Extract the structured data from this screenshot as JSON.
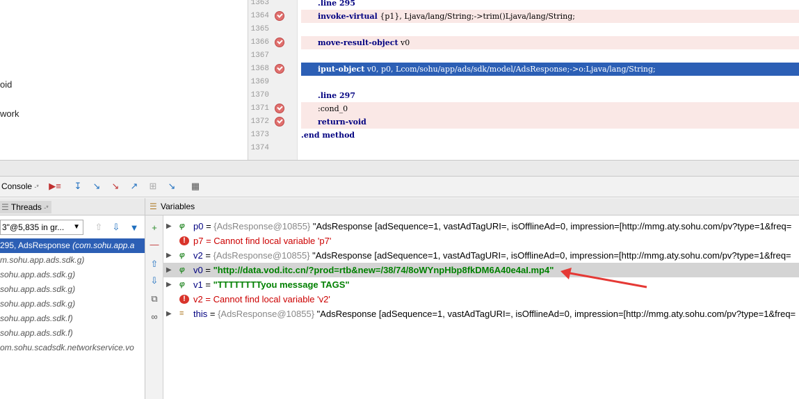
{
  "project": {
    "items": [
      "oid",
      "work"
    ]
  },
  "editor": {
    "lines": [
      {
        "num": "1363",
        "code": ".line 295",
        "bp": false,
        "indent": 1
      },
      {
        "num": "1364",
        "code": "invoke-virtual {p1}, Ljava/lang/String;->trim()Ljava/lang/String;",
        "bp": true,
        "indent": 1,
        "kw": "invoke-virtual"
      },
      {
        "num": "1365",
        "code": "",
        "bp": false,
        "indent": 1
      },
      {
        "num": "1366",
        "code": "move-result-object v0",
        "bp": true,
        "indent": 1,
        "kw": "move-result-object"
      },
      {
        "num": "1367",
        "code": "",
        "bp": false,
        "indent": 1
      },
      {
        "num": "1368",
        "code": "iput-object v0, p0, Lcom/sohu/app/ads/sdk/model/AdsResponse;->o:Ljava/lang/String;",
        "bp": true,
        "indent": 1,
        "kw": "iput-object",
        "selected": true
      },
      {
        "num": "1369",
        "code": "",
        "bp": false,
        "indent": 1
      },
      {
        "num": "1370",
        "code": ".line 297",
        "bp": false,
        "indent": 1
      },
      {
        "num": "1371",
        "code": ":cond_0",
        "bp": true,
        "indent": 1
      },
      {
        "num": "1372",
        "code": "return-void",
        "bp": true,
        "indent": 1,
        "kw": "return-void"
      },
      {
        "num": "1373",
        "code": ".end method",
        "bp": false,
        "indent": 0
      },
      {
        "num": "1374",
        "code": "",
        "bp": false,
        "indent": 0
      }
    ]
  },
  "debug_toolbar": {
    "console_tab": "Console"
  },
  "threads": {
    "tab_label": "Threads",
    "combo_value": "3\"@5,835 in gr...",
    "frames": [
      {
        "text": "295, AdsResponse ",
        "pkg": "(com.sohu.app.a",
        "selected": true
      },
      {
        "text": "",
        "pkg": "m.sohu.app.ads.sdk.g)",
        "selected": false
      },
      {
        "text": "",
        "pkg": "sohu.app.ads.sdk.g)",
        "selected": false
      },
      {
        "text": "",
        "pkg": "sohu.app.ads.sdk.g)",
        "selected": false
      },
      {
        "text": "",
        "pkg": "sohu.app.ads.sdk.g)",
        "selected": false
      },
      {
        "text": "",
        "pkg": "sohu.app.ads.sdk.f)",
        "selected": false
      },
      {
        "text": "",
        "pkg": "sohu.app.ads.sdk.f)",
        "selected": false
      },
      {
        "text": "",
        "pkg": "om.sohu.scadsdk.networkservice.vo",
        "selected": false
      }
    ]
  },
  "variables": {
    "tab_label": "Variables",
    "rows": [
      {
        "kind": "var",
        "expand": true,
        "name": "p0",
        "type": "{AdsResponse@10855}",
        "value": "\"AdsResponse [adSequence=1, vastAdTagURI=, isOfflineAd=0, impression=[http://mmg.aty.sohu.com/pv?type=1&freq="
      },
      {
        "kind": "error",
        "expand": false,
        "name": "p7",
        "value": "Cannot find local variable 'p7'"
      },
      {
        "kind": "var",
        "expand": true,
        "name": "v2",
        "type": "{AdsResponse@10855}",
        "value": "\"AdsResponse [adSequence=1, vastAdTagURI=, isOfflineAd=0, impression=[http://mmg.aty.sohu.com/pv?type=1&freq="
      },
      {
        "kind": "str",
        "expand": true,
        "name": "v0",
        "value": "\"http://data.vod.itc.cn/?prod=rtb&new=/38/74/8oWYnpHbp8fkDM6A40e4aI.mp4\"",
        "highlight": true
      },
      {
        "kind": "str",
        "expand": true,
        "name": "v1",
        "value": "\"TTTTTTTTyou message TAGS\""
      },
      {
        "kind": "error",
        "expand": false,
        "name": "v2",
        "value": "Cannot find local variable 'v2'"
      },
      {
        "kind": "field",
        "expand": true,
        "name": "this",
        "type": "{AdsResponse@10855}",
        "value": "\"AdsResponse [adSequence=1, vastAdTagURI=, isOfflineAd=0, impression=[http://mmg.aty.sohu.com/pv?type=1&freq="
      }
    ]
  },
  "colors": {
    "selection": "#2c5fb5",
    "breakpoint": "#e0706e",
    "annotation_arrow": "#e53935"
  }
}
